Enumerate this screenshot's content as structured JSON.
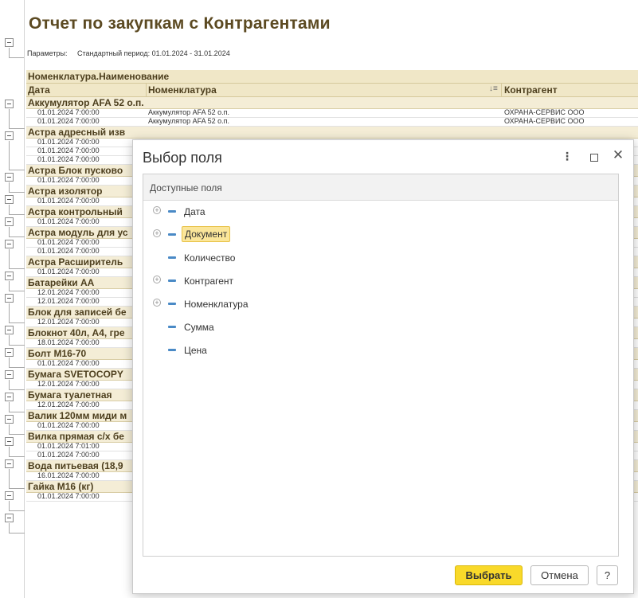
{
  "report": {
    "title": "Отчет по закупкам с Контрагентами",
    "params_label": "Параметры:",
    "params_value": "Стандартный период: 01.01.2024 - 31.01.2024",
    "header1": "Номенклатура.Наименование",
    "col_date": "Дата",
    "col_item": "Номенклатура",
    "col_counterparty": "Контрагент",
    "groups": [
      {
        "name": "Аккумулятор AFA 52  о.п.",
        "rows": [
          {
            "date": "01.01.2024 7:00:00",
            "item": "Аккумулятор AFA 52  о.п.",
            "cp": "ОХРАНА-СЕРВИС ООО"
          },
          {
            "date": "01.01.2024 7:00:00",
            "item": "Аккумулятор AFA 52  о.п.",
            "cp": "ОХРАНА-СЕРВИС ООО"
          }
        ]
      },
      {
        "name": "Астра адресный изв",
        "rows": [
          {
            "date": "01.01.2024 7:00:00",
            "item": "",
            "cp": ""
          },
          {
            "date": "01.01.2024 7:00:00",
            "item": "",
            "cp": ""
          },
          {
            "date": "01.01.2024 7:00:00",
            "item": "",
            "cp": ""
          }
        ]
      },
      {
        "name": "Астра Блок пусково",
        "rows": [
          {
            "date": "01.01.2024 7:00:00",
            "item": "",
            "cp": ""
          }
        ]
      },
      {
        "name": "Астра изолятор",
        "rows": [
          {
            "date": "01.01.2024 7:00:00",
            "item": "",
            "cp": ""
          }
        ]
      },
      {
        "name": "Астра контрольный",
        "rows": [
          {
            "date": "01.01.2024 7:00:00",
            "item": "",
            "cp": ""
          }
        ]
      },
      {
        "name": "Астра модуль для ус",
        "rows": [
          {
            "date": "01.01.2024 7:00:00",
            "item": "",
            "cp": ""
          },
          {
            "date": "01.01.2024 7:00:00",
            "item": "",
            "cp": ""
          }
        ]
      },
      {
        "name": "Астра Расширитель",
        "rows": [
          {
            "date": "01.01.2024 7:00:00",
            "item": "",
            "cp": ""
          }
        ]
      },
      {
        "name": "Батарейки АА",
        "rows": [
          {
            "date": "12.01.2024 7:00:00",
            "item": "",
            "cp": ""
          },
          {
            "date": "12.01.2024 7:00:00",
            "item": "",
            "cp": ""
          }
        ]
      },
      {
        "name": "Блок для записей бе",
        "rows": [
          {
            "date": "12.01.2024 7:00:00",
            "item": "",
            "cp": ""
          }
        ]
      },
      {
        "name": "Блокнот 40л, А4, гре",
        "rows": [
          {
            "date": "18.01.2024 7:00:00",
            "item": "",
            "cp": ""
          }
        ]
      },
      {
        "name": "Болт М16-70",
        "rows": [
          {
            "date": "01.01.2024 7:00:00",
            "item": "",
            "cp": ""
          }
        ]
      },
      {
        "name": "Бумага SVETOCOPY",
        "rows": [
          {
            "date": "12.01.2024 7:00:00",
            "item": "",
            "cp": ""
          }
        ]
      },
      {
        "name": "Бумага туалетная",
        "rows": [
          {
            "date": "12.01.2024 7:00:00",
            "item": "",
            "cp": ""
          }
        ]
      },
      {
        "name": "Валик 120мм миди м",
        "rows": [
          {
            "date": "01.01.2024 7:00:00",
            "item": "",
            "cp": ""
          }
        ]
      },
      {
        "name": "Вилка прямая с/х бе",
        "rows": [
          {
            "date": "01.01.2024 7:01:00",
            "item": "",
            "cp": ""
          },
          {
            "date": "01.01.2024 7:00:00",
            "item": "",
            "cp": ""
          }
        ]
      },
      {
        "name": "Вода питьевая  (18,9",
        "rows": [
          {
            "date": "16.01.2024 7:00:00",
            "item": "",
            "cp": ""
          }
        ]
      },
      {
        "name": "Гайка М16 (кг)",
        "rows": [
          {
            "date": "01.01.2024 7:00:00",
            "item": "",
            "cp": ""
          }
        ]
      }
    ]
  },
  "dialog": {
    "title": "Выбор поля",
    "fields_header": "Доступные поля",
    "fields": [
      {
        "label": "Дата",
        "expandable": true,
        "selected": false
      },
      {
        "label": "Документ",
        "expandable": true,
        "selected": true
      },
      {
        "label": "Количество",
        "expandable": false,
        "selected": false
      },
      {
        "label": "Контрагент",
        "expandable": true,
        "selected": false
      },
      {
        "label": "Номенклатура",
        "expandable": true,
        "selected": false
      },
      {
        "label": "Сумма",
        "expandable": false,
        "selected": false
      },
      {
        "label": "Цена",
        "expandable": false,
        "selected": false
      }
    ],
    "ok_label": "Выбрать",
    "cancel_label": "Отмена",
    "help_label": "?",
    "menu_glyph": "⋮",
    "close_glyph": "✕"
  },
  "colors": {
    "accent_button": "#f9d92a",
    "selection": "#fbe69a",
    "header_fill": "#f0e7c7",
    "field_icon": "#4a8ac6"
  }
}
